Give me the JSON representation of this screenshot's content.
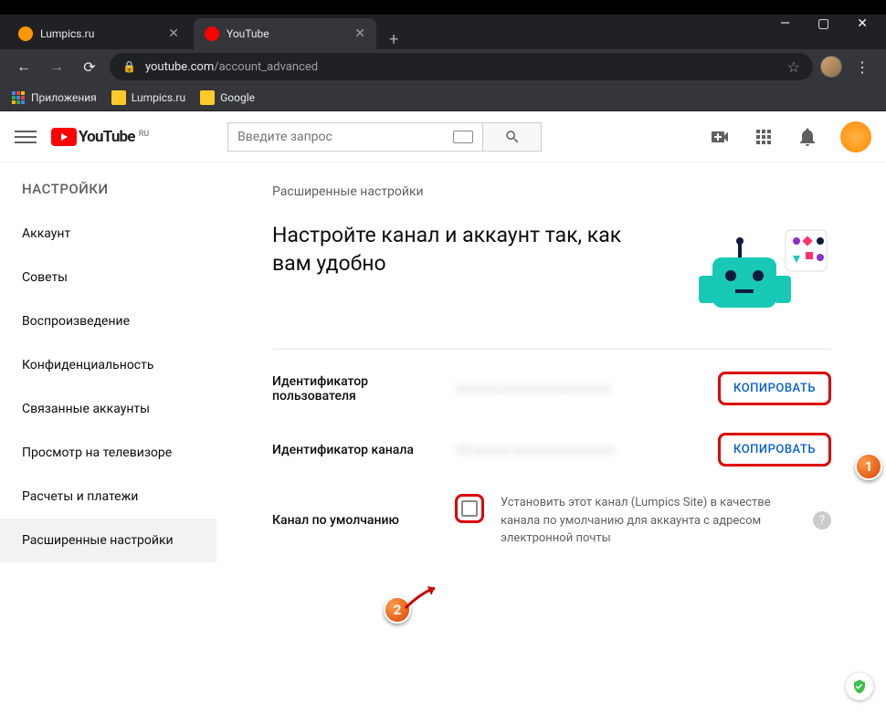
{
  "window": {
    "min": "—",
    "max": "▢",
    "close": "✕"
  },
  "tabs": [
    {
      "title": "Lumpics.ru",
      "favicon": "#ff9800"
    },
    {
      "title": "YouTube",
      "favicon": "#ff0000"
    }
  ],
  "newtab": "+",
  "nav": {
    "back": "←",
    "fwd": "→",
    "reload": "⟳"
  },
  "url": {
    "host": "youtube.com",
    "path": "/account_advanced"
  },
  "bookmarks": {
    "apps": "Приложения",
    "items": [
      "Lumpics.ru",
      "Google"
    ]
  },
  "yt": {
    "logo": "YouTube",
    "region": "RU",
    "search_placeholder": "Введите запрос"
  },
  "sidebar": {
    "header": "НАСТРОЙКИ",
    "items": [
      "Аккаунт",
      "Советы",
      "Воспроизведение",
      "Конфиденциальность",
      "Связанные аккаунты",
      "Просмотр на телевизоре",
      "Расчеты и платежи",
      "Расширенные настройки"
    ]
  },
  "main": {
    "section": "Расширенные настройки",
    "heading": "Настройте канал и аккаунт так, как вам удобно",
    "user_id_label": "Идентификатор пользователя",
    "user_id_val": "xxxxxxx-xxxxxxxxxxxxxxxxx",
    "channel_id_label": "Идентификатор канала",
    "channel_id_val": "UCxxxxxx-xxxxxxxxxxxxxxxx",
    "copy": "КОПИРОВАТЬ",
    "default_label": "Канал по умолчанию",
    "default_text": "Установить этот канал (Lumpics Site) в качестве канала по умолчанию для аккаунта с адресом электронной почты"
  },
  "callouts": {
    "c1": "1",
    "c2": "2"
  }
}
